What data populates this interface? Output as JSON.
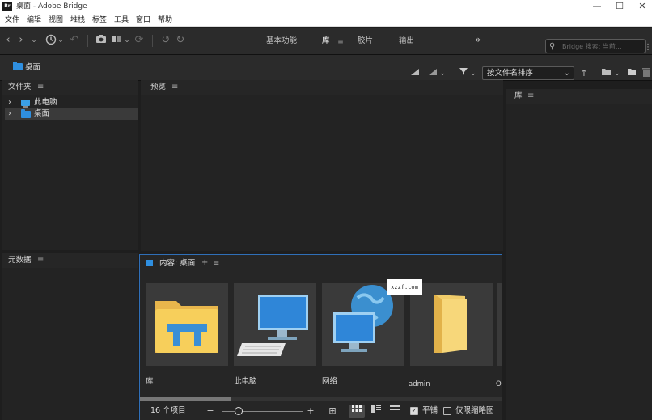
{
  "window": {
    "app_icon_text": "Br",
    "title": "桌面 - Adobe Bridge",
    "minimize": "—",
    "maximize": "☐",
    "close": "✕"
  },
  "menu": [
    "文件",
    "编辑",
    "视图",
    "堆栈",
    "标签",
    "工具",
    "窗口",
    "帮助"
  ],
  "workspace_tabs": [
    {
      "label": "基本功能",
      "active": false
    },
    {
      "label": "库",
      "active": true
    },
    {
      "label": "胶片",
      "active": false
    },
    {
      "label": "输出",
      "active": false
    }
  ],
  "workspace_more": "»",
  "search": {
    "placeholder": "Bridge 搜索: 当前..."
  },
  "path": {
    "current": "桌面"
  },
  "sort": {
    "label": "按文件名排序"
  },
  "panels": {
    "folders": "文件夹",
    "preview": "预览",
    "metadata": "元数据",
    "library": "库"
  },
  "tree": [
    {
      "label": "此电脑",
      "selected": false,
      "icon": "computer-icon"
    },
    {
      "label": "桌面",
      "selected": true,
      "icon": "folder-icon"
    }
  ],
  "content": {
    "title": "内容: 桌面",
    "add": "+",
    "items": [
      {
        "label": "库",
        "icon": "library-folder-icon"
      },
      {
        "label": "此电脑",
        "icon": "computer-icon"
      },
      {
        "label": "网络",
        "icon": "network-globe-icon"
      },
      {
        "label": "admin",
        "icon": "user-folder-icon"
      },
      {
        "label": "O",
        "icon": "partial-item"
      }
    ],
    "count": "16 个项目",
    "zoom_out": "−",
    "zoom_in": "+",
    "tile_label": "平铺",
    "thumb_only_label": "仅限缩略图",
    "tile_checked": true,
    "thumb_only_checked": false
  },
  "watermark": "xzzf.com",
  "colors": {
    "accent": "#2f8fe0",
    "panel": "#232323",
    "border_active": "#2f6fb8"
  }
}
